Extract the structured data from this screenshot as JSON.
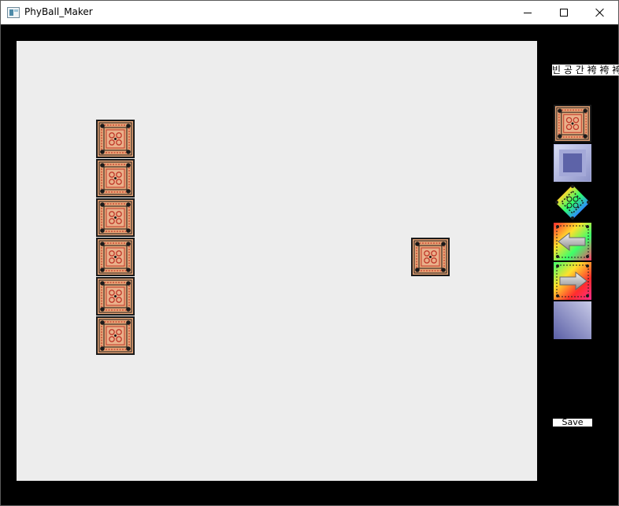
{
  "window": {
    "title": "PhyBall_Maker",
    "controls": [
      "minimize",
      "maximize",
      "close"
    ]
  },
  "canvas": {
    "background": "#ededed",
    "placed_tiles": [
      {
        "type": "brick"
      },
      {
        "type": "brick"
      },
      {
        "type": "brick"
      },
      {
        "type": "brick"
      },
      {
        "type": "brick"
      },
      {
        "type": "brick"
      },
      {
        "type": "brick"
      }
    ]
  },
  "palette": {
    "label": "빈 공 간 袴 袴 袴",
    "items": [
      {
        "name": "brick",
        "icon": "ornate-brick-icon"
      },
      {
        "name": "glass-block",
        "icon": "blue-block-icon"
      },
      {
        "name": "rainbow-diamond",
        "icon": "rainbow-diamond-icon"
      },
      {
        "name": "left-arrow-block",
        "icon": "left-arrow-block-icon"
      },
      {
        "name": "right-arrow-block",
        "icon": "right-arrow-block-icon"
      },
      {
        "name": "blue-gradient-block",
        "icon": "gradient-block-icon"
      }
    ]
  },
  "save_label": "Save",
  "colors": {
    "brick_fill": "#e8a577",
    "brick_dark": "#1a1a1a",
    "brick_red": "#c0392b",
    "frame": "#000000"
  }
}
